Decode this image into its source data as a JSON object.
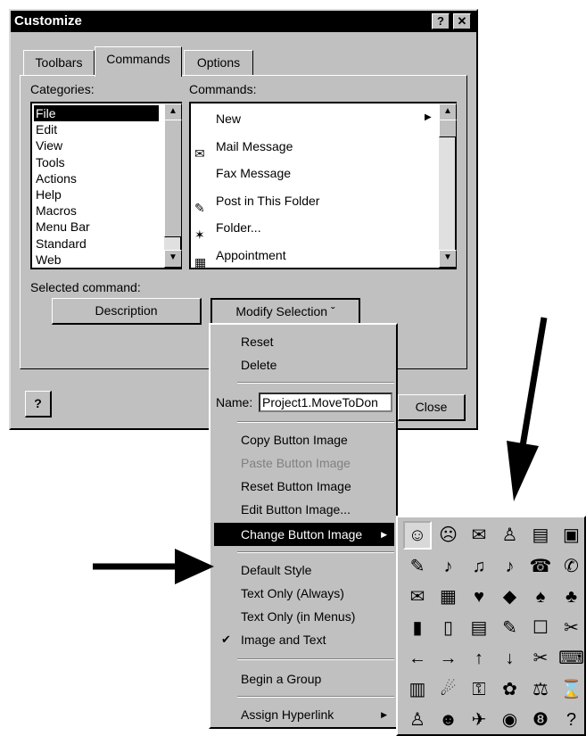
{
  "window": {
    "title": "Customize",
    "help_btn": "?",
    "close_btn": "✕"
  },
  "tabs": [
    "Toolbars",
    "Commands",
    "Options"
  ],
  "categories_label": "Categories:",
  "commands_label": "Commands:",
  "categories": [
    "File",
    "Edit",
    "View",
    "Tools",
    "Actions",
    "Help",
    "Macros",
    "Menu Bar",
    "Standard",
    "Web"
  ],
  "commands": [
    {
      "label": "New",
      "icon": "none"
    },
    {
      "label": "Mail Message",
      "icon": "mail-icon"
    },
    {
      "label": "Fax Message",
      "icon": "none"
    },
    {
      "label": "Post in This Folder",
      "icon": "post-icon"
    },
    {
      "label": "Folder...",
      "icon": "folder-icon"
    },
    {
      "label": "Appointment",
      "icon": "calendar-icon"
    }
  ],
  "selected_command_label": "Selected command:",
  "description_btn": "Description",
  "modify_btn": "Modify Selection ˇ",
  "help_icon": "?",
  "close_btn_label": "Close",
  "menu": {
    "reset": "Reset",
    "delete": "Delete",
    "name_label": "Name:",
    "name_value": "Project1.MoveToDon",
    "copy_image": "Copy Button Image",
    "paste_image": "Paste Button Image",
    "reset_image": "Reset Button Image",
    "edit_image": "Edit Button Image...",
    "change_image": "Change Button Image",
    "default_style": "Default Style",
    "text_only_always": "Text Only (Always)",
    "text_only_menus": "Text Only (in Menus)",
    "image_and_text": "Image and Text",
    "begin_group": "Begin a Group",
    "assign_hyperlink": "Assign Hyperlink",
    "check": "✔"
  },
  "palette": [
    [
      "☺",
      "☹",
      "✉",
      "♙",
      "▤",
      "▣"
    ],
    [
      "✎",
      "♪",
      "♫",
      "♪",
      "☎",
      "✆"
    ],
    [
      "✉",
      "▦",
      "♥",
      "◆",
      "♠",
      "♣"
    ],
    [
      "▮",
      "▯",
      "▤",
      "✎",
      "☐",
      "✂"
    ],
    [
      "←",
      "→",
      "↑",
      "↓",
      "✂",
      "⌨"
    ],
    [
      "▥",
      "☄",
      "⚿",
      "✿",
      "⚖",
      "⌛"
    ],
    [
      "♙",
      "☻",
      "✈",
      "◉",
      "❽",
      "?"
    ]
  ]
}
